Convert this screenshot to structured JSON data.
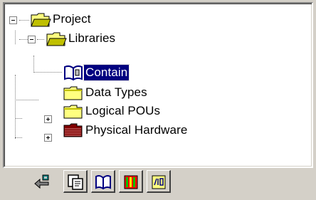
{
  "tree": {
    "items": [
      {
        "label": "Project",
        "icon": "folder-open-icon",
        "expander": "minus"
      },
      {
        "label": "Libraries",
        "icon": "folder-open-icon",
        "expander": "minus"
      },
      {
        "label": "Contain",
        "icon": "library-book-icon",
        "selected": true
      },
      {
        "label": "Data Types",
        "icon": "folder-icon"
      },
      {
        "label": "Logical POUs",
        "icon": "folder-icon",
        "expander": "plus"
      },
      {
        "label": "Physical Hardware",
        "icon": "hardware-folder-icon",
        "expander": "plus"
      }
    ]
  },
  "tabs": [
    {
      "icon": "project-tree-icon",
      "active": true
    },
    {
      "icon": "document-icon",
      "active": false
    },
    {
      "icon": "library-book-icon",
      "active": false
    },
    {
      "icon": "hardware-rack-icon",
      "active": false
    },
    {
      "icon": "io-variables-icon",
      "active": false
    }
  ],
  "colors": {
    "selection": "#000080",
    "folder": "#ffff80",
    "folder_dark": "#c0c000",
    "hardware_folder": "#800000",
    "panel": "#d4d0c8"
  }
}
